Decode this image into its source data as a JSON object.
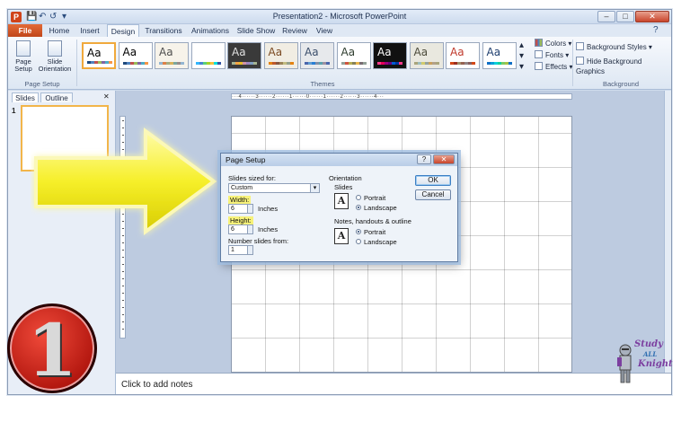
{
  "window": {
    "title": "Presentation2 - Microsoft PowerPoint",
    "app_logo": "P",
    "qat": [
      "💾",
      "↶",
      "↺",
      "▾"
    ],
    "controls": [
      "–",
      "□",
      "✕"
    ]
  },
  "tabs": [
    {
      "label": "File"
    },
    {
      "label": "Home"
    },
    {
      "label": "Insert"
    },
    {
      "label": "Design"
    },
    {
      "label": "Transitions"
    },
    {
      "label": "Animations"
    },
    {
      "label": "Slide Show"
    },
    {
      "label": "Review"
    },
    {
      "label": "View"
    }
  ],
  "ribbon": {
    "page_setup": {
      "label": "Page Setup",
      "page_setup_btn": "Page Setup",
      "orientation_btn": "Slide Orientation"
    },
    "themes_label": "Themes",
    "theme_aa": "Aa",
    "colors": "Colors",
    "fonts": "Fonts",
    "effects": "Effects",
    "background_styles": "Background Styles",
    "hide_background": "Hide Background Graphics",
    "background_label": "Background"
  },
  "colors": {
    "theme_swatches": [
      [
        "#1f497d",
        "#4f81bd",
        "#c0504d",
        "#9bbb59",
        "#8064a2",
        "#4bacc6",
        "#f79646"
      ],
      [
        "#1f497d",
        "#4f81bd",
        "#c0504d",
        "#9bbb59",
        "#8064a2",
        "#4bacc6",
        "#f79646"
      ],
      [
        "#94b6d2",
        "#dd8047",
        "#a5ab81",
        "#d8b25c",
        "#7ba79d",
        "#968c8c",
        "#94b6d2"
      ],
      [
        "#31b6fd",
        "#4584d3",
        "#5bd078",
        "#a5d028",
        "#f5c040",
        "#05e0db",
        "#3153a4"
      ],
      [
        "#a5b592",
        "#f3a447",
        "#e7bc29",
        "#d092a7",
        "#9c85c0",
        "#809ec2",
        "#a5b592"
      ],
      [
        "#e48312",
        "#bd582c",
        "#865640",
        "#9b8357",
        "#c2bc80",
        "#94a088",
        "#e48312"
      ],
      [
        "#4a66ac",
        "#629dd1",
        "#297fd5",
        "#7f8fa9",
        "#5aa2ae",
        "#9d90a0",
        "#4a66ac"
      ],
      [
        "#93a299",
        "#cf543f",
        "#b5ae53",
        "#848058",
        "#e8b54d",
        "#786c71",
        "#93a299"
      ],
      [
        "#ff388c",
        "#e40059",
        "#9c007f",
        "#68007f",
        "#005bd3",
        "#00349e",
        "#ff388c"
      ],
      [
        "#a9a57c",
        "#9cbebd",
        "#d2cb6c",
        "#95a39d",
        "#c89f5d",
        "#b1a089",
        "#a9a57c"
      ],
      [
        "#d34817",
        "#9b2d1f",
        "#a28e6a",
        "#956251",
        "#918485",
        "#855d5d",
        "#d34817"
      ],
      [
        "#0f6fc6",
        "#009dd9",
        "#0bd0d9",
        "#10cf9b",
        "#7cca62",
        "#a5c249",
        "#0f6fc6"
      ]
    ],
    "theme_backgrounds": [
      "#ffffff",
      "#ffffff",
      "#f7f3ea",
      "#ffffff",
      "#3a3a3a",
      "#f1ede3",
      "#e7e9ec",
      "#ffffff",
      "#111111",
      "#e9e8df",
      "#ffffff",
      "#ffffff"
    ],
    "theme_text": [
      "#000000",
      "#000000",
      "#4f4f4f",
      "#ffffff",
      "#e0e0e0",
      "#7a4a22",
      "#3b4e6b",
      "#2f3d2f",
      "#ffffff",
      "#4b4a3a",
      "#c0392b",
      "#1f3f6f"
    ]
  },
  "slides_pane": {
    "tab_slides": "Slides",
    "tab_outline": "Outline",
    "close": "✕",
    "slide_number": "1"
  },
  "ruler": {
    "text": "···4······3······2······1······0······1······2······3······4···"
  },
  "dialog": {
    "title": "Page Setup",
    "help": "?",
    "close": "✕",
    "slides_sized_for_label": "Slides sized for:",
    "slides_sized_for_value": "Custom",
    "width_label": "Width:",
    "width_value": "6",
    "width_unit": "Inches",
    "height_label": "Height:",
    "height_value": "6",
    "height_unit": "Inches",
    "number_from_label": "Number slides from:",
    "number_from_value": "1",
    "orientation_label": "Orientation",
    "slides_label": "Slides",
    "portrait": "Portrait",
    "landscape": "Landscape",
    "notes_label": "Notes, handouts & outline",
    "ok": "OK",
    "cancel": "Cancel"
  },
  "notes": {
    "placeholder": "Click to add notes"
  },
  "overlay": {
    "step_number": "1",
    "logo_line1": "Study",
    "logo_line2": "ALL",
    "logo_line3": "Knight"
  }
}
